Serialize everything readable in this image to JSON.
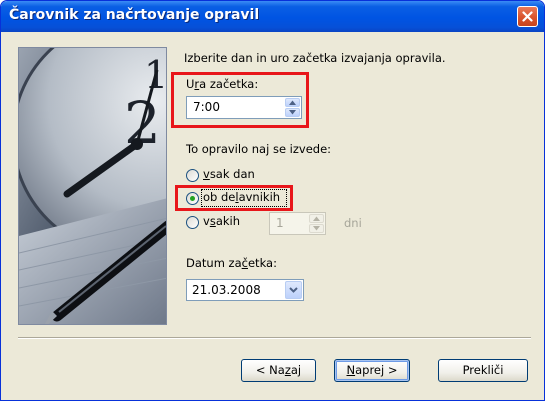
{
  "window": {
    "title": "Čarovnik za načrtovanje opravil"
  },
  "form": {
    "instruction": "Izberite dan in uro začetka izvajanja opravila.",
    "start_time": {
      "label_pre": "U",
      "label_key": "r",
      "label_post": "a začetka:",
      "value": "7:00"
    },
    "run_group": {
      "label": "To opravilo naj se izvede:",
      "options": [
        {
          "pre": "",
          "key": "v",
          "post": "sak dan",
          "selected": false
        },
        {
          "pre": "ob de",
          "key": "l",
          "post": "avnikih",
          "selected": true
        },
        {
          "pre": "v",
          "key": "s",
          "post": "akih",
          "selected": false
        }
      ],
      "every_n_value": "1",
      "every_n_unit": "dni"
    },
    "start_date": {
      "label_pre": "Datum za",
      "label_key": "č",
      "label_post": "etka:",
      "value": "21.03.2008"
    }
  },
  "buttons": {
    "back": {
      "pre": "< Na",
      "key": "z",
      "post": "aj"
    },
    "next": {
      "pre": "",
      "key": "N",
      "post": "aprej >"
    },
    "cancel": {
      "label": "Prekliči"
    }
  },
  "colors": {
    "titlebar": "#0054e3",
    "dialog_bg": "#ece9d8",
    "highlight_box": "#e8161a",
    "radio_dot": "#21a121"
  },
  "icons": {
    "close": "close-icon",
    "spin_up": "arrow-up-icon",
    "spin_down": "arrow-down-icon",
    "dropdown": "chevron-down-icon"
  }
}
